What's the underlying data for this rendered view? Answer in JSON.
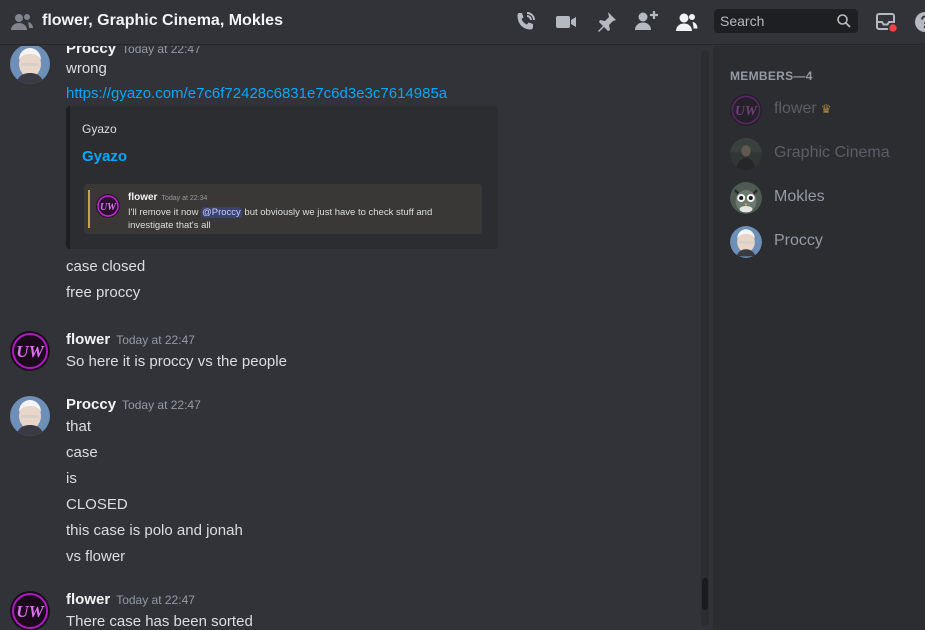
{
  "header": {
    "title": "flower, Graphic Cinema, Mokles",
    "search_placeholder": "Search"
  },
  "messages": [
    {
      "author": "Proccy",
      "timestamp": "Today at 22:47",
      "lines": [
        "wrong"
      ],
      "link": "https://gyazo.com/e7c6f72428c6831e7c6d3e3c7614985a",
      "embed": {
        "provider": "Gyazo",
        "title": "Gyazo",
        "preview": {
          "author": "flower",
          "timestamp": "Today at 22:34",
          "text_before": "I'll remove it now ",
          "mention": "@Proccy",
          "text_after": " but obviously we just have to check stuff and investigate that's all"
        }
      },
      "after_lines": [
        "case closed",
        "free proccy"
      ]
    },
    {
      "author": "flower",
      "timestamp": "Today at 22:47",
      "lines": [
        "So here it is proccy vs the people"
      ]
    },
    {
      "author": "Proccy",
      "timestamp": "Today at 22:47",
      "lines": [
        "that",
        "case",
        "is",
        "CLOSED",
        "this case is polo and jonah",
        "vs flower"
      ]
    },
    {
      "author": "flower",
      "timestamp": "Today at 22:47",
      "lines": [
        "There case has been sorted"
      ]
    }
  ],
  "members": {
    "heading": "MEMBERS—4",
    "list": [
      {
        "name": "flower",
        "owner": true,
        "dim": true
      },
      {
        "name": "Graphic Cinema",
        "owner": false,
        "dim": true
      },
      {
        "name": "Mokles",
        "owner": false,
        "dim": false
      },
      {
        "name": "Proccy",
        "owner": false,
        "dim": false
      }
    ]
  },
  "colors": {
    "background": "#313338",
    "sidebar": "#2b2d31",
    "link": "#00a8fc",
    "notification": "#f23f43"
  }
}
